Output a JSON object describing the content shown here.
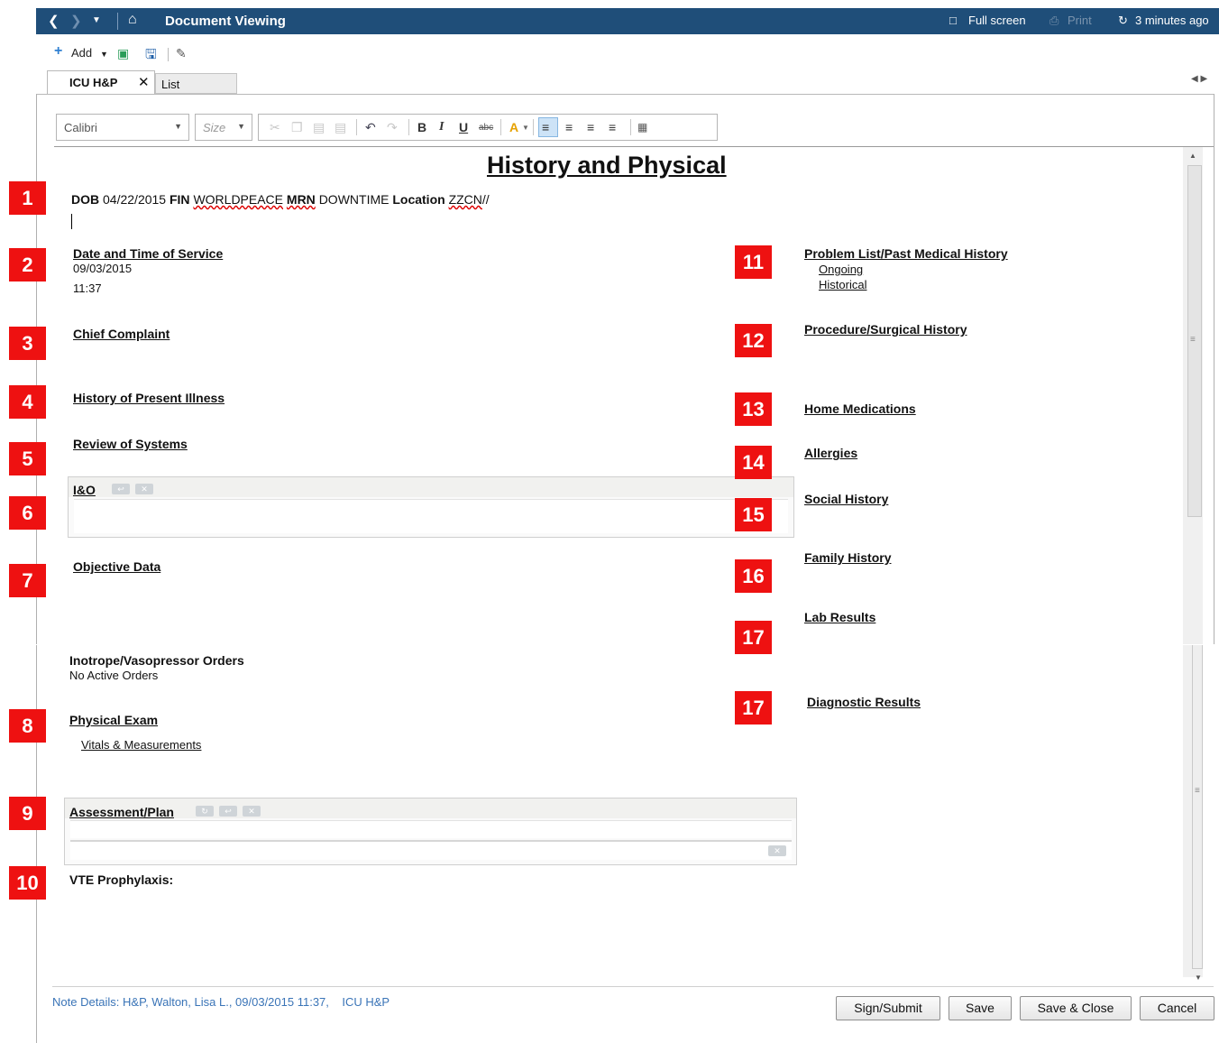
{
  "titlebar": {
    "title": "Document Viewing",
    "fullscreen_label": "Full screen",
    "print_label": "Print",
    "refresh_label": "3 minutes ago"
  },
  "toolbar": {
    "add_label": "Add"
  },
  "tabs": [
    {
      "label": "ICU H&P",
      "active": true
    },
    {
      "label": "List",
      "active": false
    }
  ],
  "format_toolbar": {
    "font_value": "Calibri",
    "size_placeholder": "Size"
  },
  "document": {
    "title": "History and Physical",
    "demographics": {
      "dob_label": "DOB",
      "dob": "04/22/2015",
      "fin_label": "FIN",
      "fin": "WORLDPEACE",
      "mrn_label": "MRN",
      "mrn": "DOWNTIME",
      "location_label": "Location",
      "location": "ZZCN",
      "location_suffix": "//"
    },
    "left_sections": {
      "date_time_heading": "Date and Time of Service",
      "date": "09/03/2015",
      "time": "11:37",
      "chief_complaint": "Chief Complaint",
      "hpi": "History of Present Illness",
      "ros": "Review of Systems",
      "io": "I&O",
      "objective": "Objective Data",
      "inotrope_heading": "Inotrope/Vasopressor Orders",
      "inotrope_value": "No Active Orders",
      "physical_exam": "Physical Exam",
      "vitals_link": "Vitals & Measurements",
      "assessment_plan": "Assessment/Plan",
      "vte": "VTE Prophylaxis:"
    },
    "right_sections": {
      "problem_list": "Problem List/Past Medical History",
      "ongoing": "Ongoing",
      "historical": "Historical",
      "procedure": "Procedure/Surgical History",
      "home_meds": "Home Medications",
      "allergies": "Allergies",
      "social": "Social History",
      "family": "Family History",
      "labs": "Lab Results",
      "diagnostic": "Diagnostic Results"
    }
  },
  "badges": [
    "1",
    "2",
    "3",
    "4",
    "5",
    "6",
    "7",
    "8",
    "9",
    "10",
    "11",
    "12",
    "13",
    "14",
    "15",
    "16",
    "17",
    "17"
  ],
  "footer": {
    "note_details": "Note Details: H&P, Walton, Lisa L., 09/03/2015 11:37,    ICU H&P",
    "buttons": [
      "Sign/Submit",
      "Save",
      "Save & Close",
      "Cancel"
    ]
  },
  "colors": {
    "titlebar": "#1f4e79",
    "badge": "#ee1111",
    "link": "#3a74b7"
  }
}
